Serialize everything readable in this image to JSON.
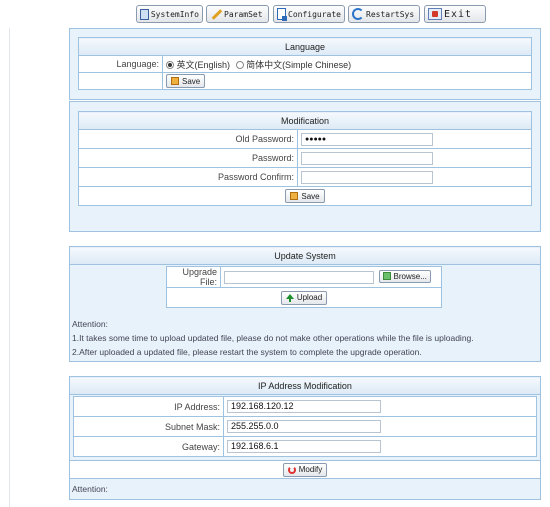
{
  "toolbar": {
    "system_info": "SystemInfo",
    "param_set": "ParamSet",
    "configurate": "Configurate",
    "restart_sys": "RestartSys",
    "exit": "Exit"
  },
  "language": {
    "header": "Language",
    "label": "Language:",
    "option_english": "英文(English)",
    "option_chinese": "简体中文(Simple Chinese)",
    "selected": "English",
    "save": "Save"
  },
  "modification": {
    "header": "Modification",
    "old_password_label": "Old Password:",
    "old_password_value": "●●●●●",
    "password_label": "Password:",
    "password_value": "",
    "confirm_label": "Password Confirm:",
    "confirm_value": "",
    "save": "Save"
  },
  "update": {
    "header": "Update System",
    "file_label": "Upgrade File:",
    "file_value": "",
    "browse": "Browse...",
    "upload": "Upload",
    "attention_title": "Attention:",
    "attention_1": "1.It takes some time to upload updated file, please do not make other operations while the file is uploading.",
    "attention_2": "2.After uploaded a updated file, please restart the system to complete the upgrade operation."
  },
  "ip": {
    "header": "IP Address Modification",
    "ip_label": "IP Address:",
    "ip_value": "192.168.120.12",
    "mask_label": "Subnet Mask:",
    "mask_value": "255.255.0.0",
    "gateway_label": "Gateway:",
    "gateway_value": "192.168.6.1",
    "modify": "Modify",
    "attention_title": "Attention:"
  },
  "icons": [
    "system-info-icon",
    "pen-icon",
    "configure-icon",
    "restart-icon",
    "exit-icon",
    "save-icon",
    "upload-icon",
    "modify-icon"
  ]
}
